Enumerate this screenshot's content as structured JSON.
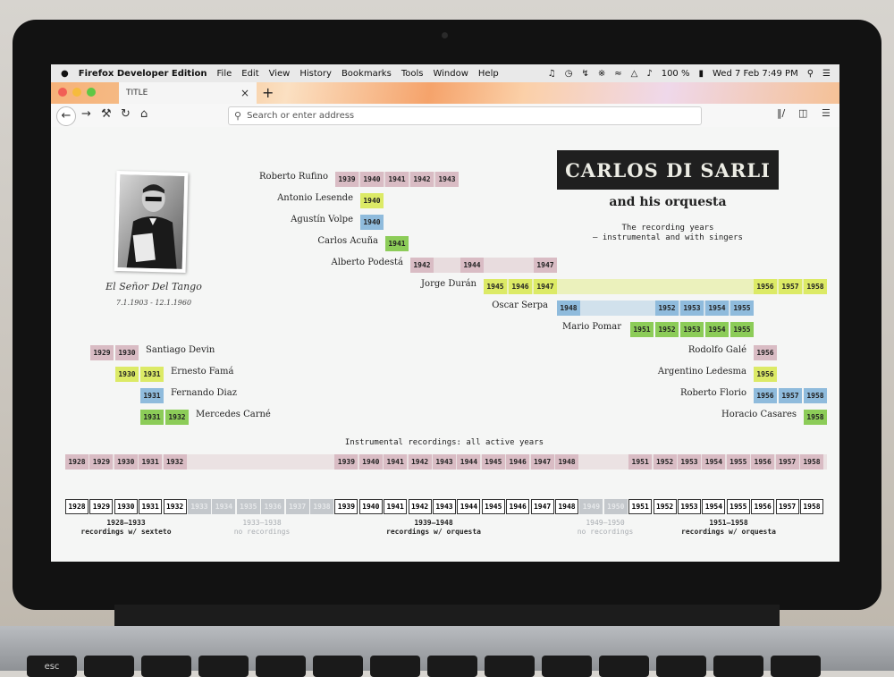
{
  "menubar": {
    "apple": "",
    "app_name": "Firefox Developer Edition",
    "items": [
      "File",
      "Edit",
      "View",
      "History",
      "Bookmarks",
      "Tools",
      "Window",
      "Help"
    ],
    "battery": "100 %",
    "clock": "Wed 7 Feb  7:49 PM"
  },
  "browser": {
    "tab_title": "TITLE",
    "tab_close": "×",
    "new_tab": "+",
    "url_placeholder": "Search or enter address"
  },
  "page": {
    "title": "CARLOS DI SARLI",
    "subtitle": "and his orquesta",
    "description_line1": "The recording years",
    "description_line2": "– instrumental and with singers",
    "photo_caption": "El Señor Del Tango",
    "photo_dates": "7.1.1903 - 12.1.1960",
    "instrumental_heading": "Instrumental recordings: all active years",
    "singers_right": [
      {
        "name": "Roberto Rufino",
        "years": [
          "1939",
          "1940",
          "1941",
          "1942",
          "1943"
        ]
      },
      {
        "name": "Antonio Lesende",
        "years": [
          "1940"
        ]
      },
      {
        "name": "Agustín Volpe",
        "years": [
          "1940"
        ]
      },
      {
        "name": "Carlos Acuña",
        "years": [
          "1941"
        ]
      },
      {
        "name": "Alberto Podestá",
        "years": [
          "1942",
          "1944",
          "1947"
        ]
      },
      {
        "name": "Jorge Durán",
        "years": [
          "1945",
          "1946",
          "1947",
          "1956",
          "1957",
          "1958"
        ]
      },
      {
        "name": "Oscar Serpa",
        "years": [
          "1948",
          "1952",
          "1953",
          "1954",
          "1955"
        ]
      },
      {
        "name": "Mario Pomar",
        "years": [
          "1951",
          "1952",
          "1953",
          "1954",
          "1955"
        ]
      }
    ],
    "singers_left": [
      {
        "name": "Santiago Devin",
        "years": [
          "1929",
          "1930"
        ]
      },
      {
        "name": "Ernesto Famá",
        "years": [
          "1930",
          "1931"
        ]
      },
      {
        "name": "Fernando Diaz",
        "years": [
          "1931"
        ]
      },
      {
        "name": "Mercedes Carné",
        "years": [
          "1931",
          "1932"
        ]
      }
    ],
    "singers_late": [
      {
        "name": "Rodolfo Galé",
        "years": [
          "1956"
        ]
      },
      {
        "name": "Argentino Ledesma",
        "years": [
          "1956"
        ]
      },
      {
        "name": "Roberto Florio",
        "years": [
          "1956",
          "1957",
          "1958"
        ]
      },
      {
        "name": "Horacio Casares",
        "years": [
          "1958"
        ]
      }
    ],
    "instrumental_years": [
      "1928",
      "1929",
      "1930",
      "1931",
      "1932",
      "1939",
      "1940",
      "1941",
      "1942",
      "1943",
      "1944",
      "1945",
      "1946",
      "1947",
      "1948",
      "1951",
      "1952",
      "1953",
      "1954",
      "1955",
      "1956",
      "1957",
      "1958"
    ],
    "timeline_years": [
      "1928",
      "1929",
      "1930",
      "1931",
      "1932",
      "1933",
      "1934",
      "1935",
      "1936",
      "1937",
      "1938",
      "1939",
      "1940",
      "1941",
      "1942",
      "1943",
      "1944",
      "1945",
      "1946",
      "1947",
      "1948",
      "1949",
      "1950",
      "1951",
      "1952",
      "1953",
      "1954",
      "1955",
      "1956",
      "1957",
      "1958"
    ],
    "periods": [
      {
        "range": "1928–1933",
        "label": "recordings w/ sexteto",
        "dim": false
      },
      {
        "range": "1933–1938",
        "label": "no recordings",
        "dim": true
      },
      {
        "range": "1939–1948",
        "label": "recordings w/ orquesta",
        "dim": false
      },
      {
        "range": "1949–1950",
        "label": "no recordings",
        "dim": true
      },
      {
        "range": "1951–1958",
        "label": "recordings w/ orquesta",
        "dim": false
      }
    ]
  },
  "keyboard": [
    "esc",
    "",
    "",
    "",
    "",
    "",
    "",
    "",
    "",
    "",
    "",
    "",
    "",
    ""
  ],
  "colors": {
    "pink": "#d9bcc4",
    "yellow": "#dcea66",
    "blue": "#8fbbdc",
    "green": "#8ccc58"
  }
}
